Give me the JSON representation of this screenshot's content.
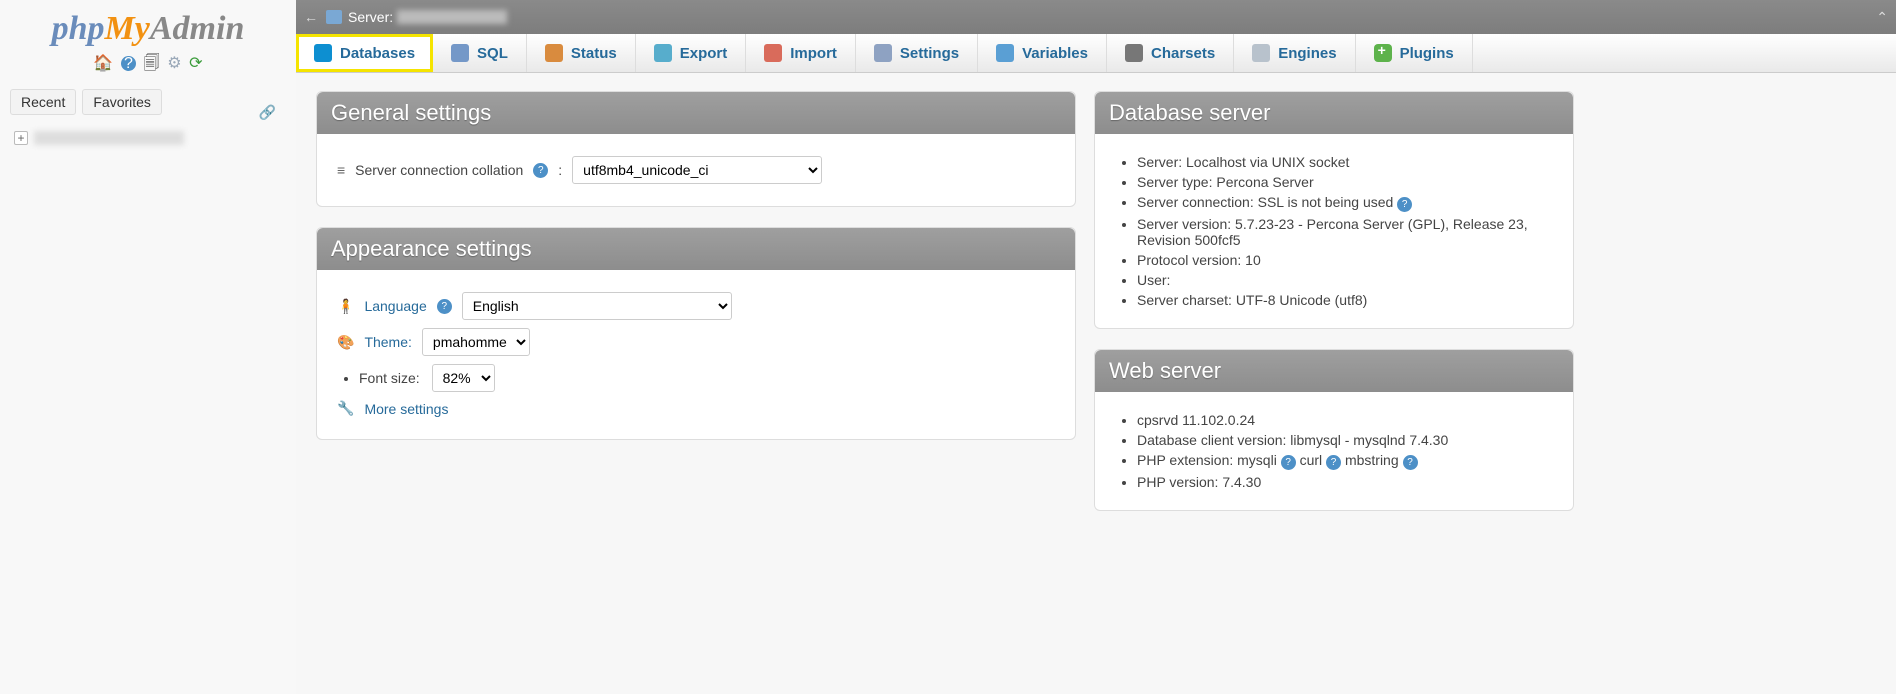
{
  "logo": {
    "php": "php",
    "my": "My",
    "admin": "Admin"
  },
  "sidebarTabs": {
    "recent": "Recent",
    "favorites": "Favorites"
  },
  "topbar": {
    "server_label": "Server:"
  },
  "mainTabs": {
    "databases": "Databases",
    "sql": "SQL",
    "status": "Status",
    "export": "Export",
    "import": "Import",
    "settings": "Settings",
    "variables": "Variables",
    "charsets": "Charsets",
    "engines": "Engines",
    "plugins": "Plugins"
  },
  "panels": {
    "general": "General settings",
    "appearance": "Appearance settings",
    "dbserver": "Database server",
    "webserver": "Web server"
  },
  "general": {
    "collation_label": "Server connection collation",
    "collation_value": "utf8mb4_unicode_ci"
  },
  "appearance": {
    "language_label": "Language",
    "language_value": "English",
    "theme_label": "Theme:",
    "theme_value": "pmahomme",
    "fontsize_label": "Font size:",
    "fontsize_value": "82%",
    "more": "More settings"
  },
  "db": {
    "i0": "Server: Localhost via UNIX socket",
    "i1": "Server type: Percona Server",
    "i2": "Server connection: SSL is not being used",
    "i3": "Server version: 5.7.23-23 - Percona Server (GPL), Release 23, Revision 500fcf5",
    "i4": "Protocol version: 10",
    "i5": "User:",
    "i6": "Server charset: UTF-8 Unicode (utf8)"
  },
  "web": {
    "i0": "cpsrvd 11.102.0.24",
    "i1": "Database client version: libmysql - mysqlnd 7.4.30",
    "i2a": "PHP extension: mysqli",
    "i2b": "curl",
    "i2c": "mbstring",
    "i3": "PHP version: 7.4.30"
  }
}
